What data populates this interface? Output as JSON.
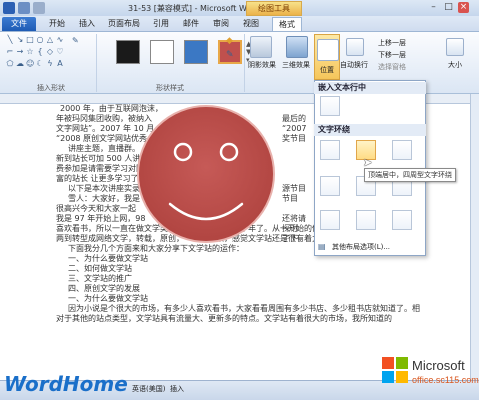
{
  "window": {
    "title": "31-53 [兼容模式] - Microsoft Word",
    "context_tool_header": "绘图工具",
    "buttons": [
      "–",
      "□",
      "×"
    ]
  },
  "tabs": [
    {
      "label": "文件"
    },
    {
      "label": "开始"
    },
    {
      "label": "插入"
    },
    {
      "label": "页面布局"
    },
    {
      "label": "引用"
    },
    {
      "label": "邮件"
    },
    {
      "label": "审阅"
    },
    {
      "label": "视图"
    },
    {
      "label": "格式"
    }
  ],
  "ribbon": {
    "groups": {
      "insert_shapes": "插入形状",
      "shape_styles": "形状样式",
      "shadow_effects": "阴影效果",
      "threed_effects": "三维效果"
    },
    "shadow_btn": "阴影效果",
    "threed_btn": "三维效果",
    "position_btn": "位置",
    "wrap_btn": "自动换行",
    "bring_forward": "上移一层",
    "send_backward": "下移一层",
    "selection_pane": "选择窗格",
    "size_btn": "大小",
    "style_colors": [
      "#1a1a1a",
      "#ffffff",
      "#3b78c4",
      "#c0504d"
    ]
  },
  "dropdown": {
    "header_inline": "嵌入文本行中",
    "header_wrap": "文字环绕",
    "more_options": "其他布局选项(L)..."
  },
  "tooltip": "顶端居中，四周型文字环绕",
  "document": {
    "lines": [
      "2000 年，由于互联网泡沫，",
      "年被玛冈集团收购，被纳入",
      "文字网站”。2007 年 10 月",
      "“2008 原创文学网站优秀",
      "讲座主题，直播群。",
      "新到站长可加 500 人讲座",
      "费参加是请需要学习对网",
      "富的站长 让更多学习了",
      "以下是本次讲座实录",
      "雪人：大家好，我是",
      "很高兴今天和大家一起",
      "我是 97 年开始上网，98",
      "喜欢看书，所以一直在做文学类，前前后后也有超过十年了。从一开始的传统文学，转型到",
      "两到转型成网络文学，转载，原创，一路做下来，感觉文学站还是很有着力的站点类型。",
      "下面我分几个方面来和大家分享下文学站的运作：",
      "一、为什么要做文学站",
      "二、如何做文学站",
      "三、文学站的推广",
      "四、原创文学的发展",
      "一、为什么要做文学站",
      "因为小说是个很大的市场，有多少人喜欢看书，大家看看周围有多少书店、多少租书店就知道了。相",
      "对于其他的站点类型，文学站具有流量大、更新多的特点。文学站有着很大的市场，我所知道的"
    ],
    "right_lines": [
      "最后的",
      "“2007",
      "奖节目",
      "源节目",
      "节目",
      "还将请",
      "探讨",
      "了下，"
    ]
  },
  "statusbar": {
    "language": "英语(美国)",
    "mode": "插入"
  },
  "watermark": {
    "left_logo": "WordHome",
    "ms_text": "Microsoft",
    "ms_url": "office.sc115.com",
    "ms_colors": [
      "#f25022",
      "#7fba00",
      "#00a4ef",
      "#ffb900"
    ]
  }
}
